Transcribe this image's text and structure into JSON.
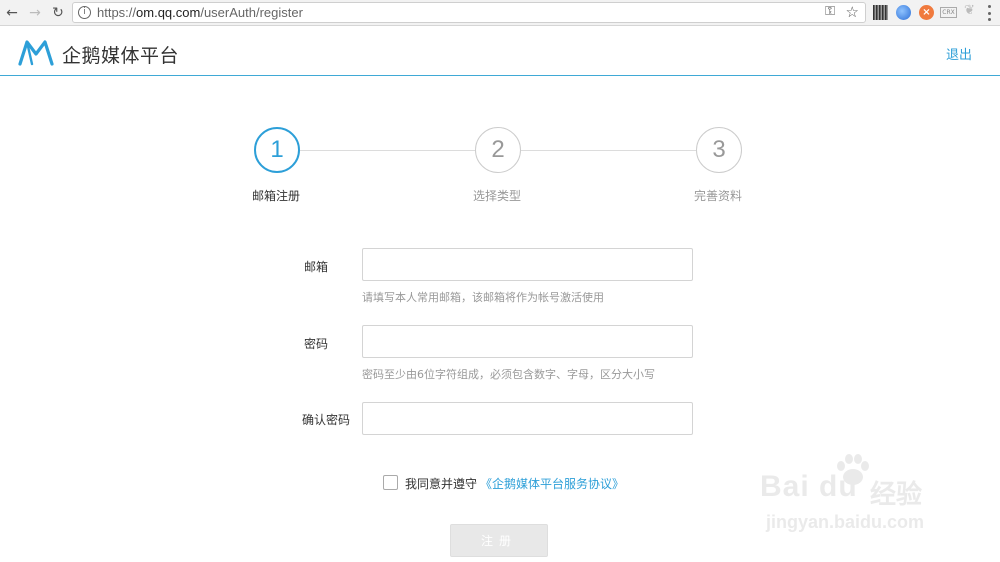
{
  "browser": {
    "url_scheme": "https://",
    "url_host": "om.qq.com",
    "url_path": "/userAuth/register",
    "crx_label": "CRX"
  },
  "header": {
    "brand": "企鹅媒体平台",
    "logout_label": "退出",
    "accent_color": "#2d9fd8"
  },
  "steps": [
    {
      "number": "1",
      "label": "邮箱注册",
      "active": true
    },
    {
      "number": "2",
      "label": "选择类型",
      "active": false
    },
    {
      "number": "3",
      "label": "完善资料",
      "active": false
    }
  ],
  "form": {
    "email_label": "邮箱",
    "email_value": "",
    "email_hint": "请填写本人常用邮箱，该邮箱将作为帐号激活使用",
    "password_label": "密码",
    "password_value": "",
    "password_hint": "密码至少由6位字符组成，必须包含数字、字母，区分大小写",
    "confirm_label": "确认密码",
    "confirm_value": "",
    "agree_text": "我同意并遵守",
    "agree_link": "《企鹅媒体平台服务协议》",
    "agree_checked": false,
    "submit_label": "注册"
  },
  "watermark": {
    "brand": "Bai du",
    "cn": "经验",
    "url": "jingyan.baidu.com"
  }
}
